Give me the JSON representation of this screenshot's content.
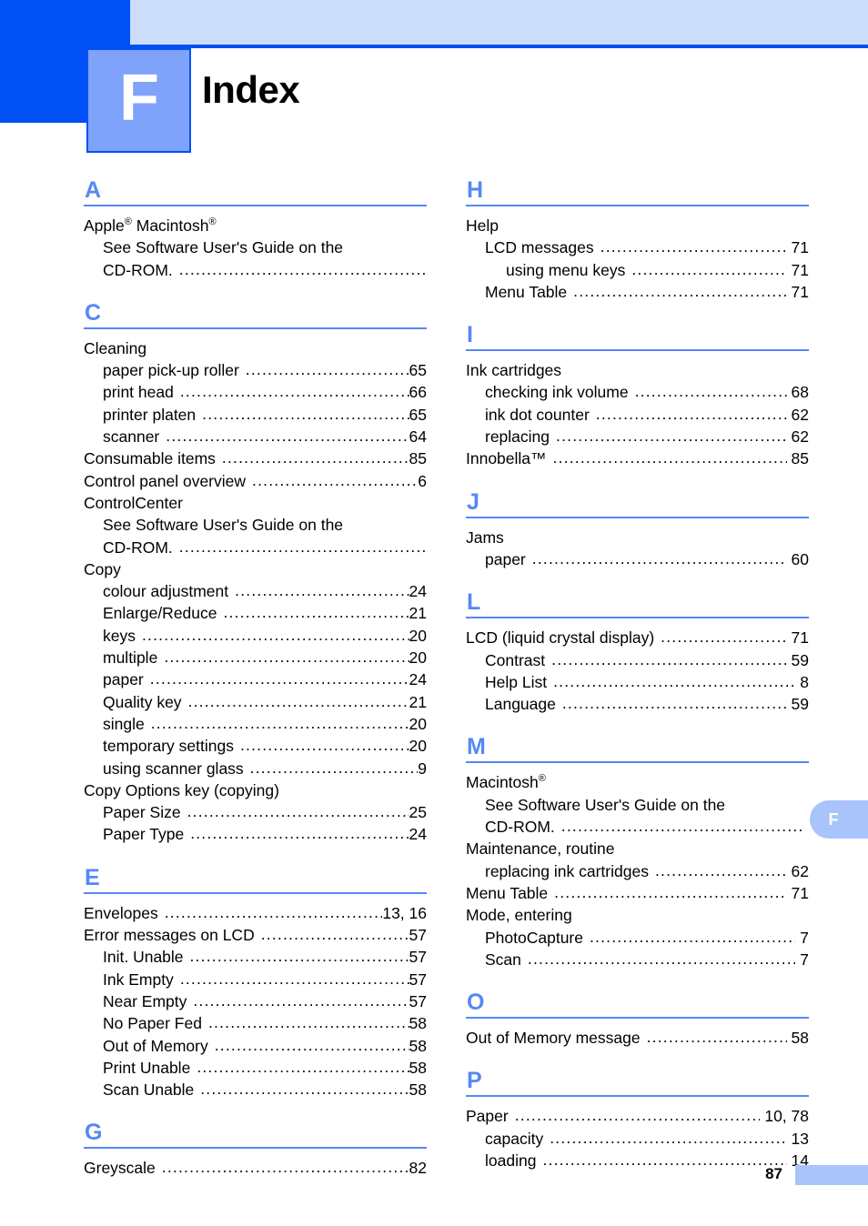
{
  "colors": {
    "brand_blue": "#0050f5",
    "band_blue": "#ccdcfb",
    "chapter_box_blue": "#7fa2fa",
    "heading_blue": "#5588f5",
    "tab_blue": "#a9c3fb"
  },
  "header": {
    "chapter_letter": "F",
    "title": "Index"
  },
  "edge_tab": {
    "label": "F"
  },
  "footer": {
    "page_number": "87"
  },
  "leader": "..................................................................................................",
  "columns": {
    "left": [
      {
        "letter": "A",
        "entries": [
          {
            "level": 1,
            "text": "Apple® Macintosh®",
            "page": "",
            "leader": false,
            "html": true
          },
          {
            "level": 2,
            "text": "See Software User's Guide on the",
            "page": "",
            "leader": false
          },
          {
            "level": 2,
            "text": "CD-ROM.",
            "page": "",
            "leader": true
          }
        ]
      },
      {
        "letter": "C",
        "entries": [
          {
            "level": 1,
            "text": "Cleaning",
            "page": "",
            "leader": false
          },
          {
            "level": 2,
            "text": "paper pick-up roller",
            "page": "65",
            "leader": true
          },
          {
            "level": 2,
            "text": "print head",
            "page": "66",
            "leader": true
          },
          {
            "level": 2,
            "text": "printer platen",
            "page": "65",
            "leader": true
          },
          {
            "level": 2,
            "text": "scanner",
            "page": "64",
            "leader": true
          },
          {
            "level": 1,
            "text": "Consumable items",
            "page": "85",
            "leader": true
          },
          {
            "level": 1,
            "text": "Control panel overview",
            "page": "6",
            "leader": true
          },
          {
            "level": 1,
            "text": "ControlCenter",
            "page": "",
            "leader": false
          },
          {
            "level": 2,
            "text": "See Software User's Guide on the",
            "page": "",
            "leader": false
          },
          {
            "level": 2,
            "text": "CD-ROM.",
            "page": "",
            "leader": true
          },
          {
            "level": 1,
            "text": "Copy",
            "page": "",
            "leader": false
          },
          {
            "level": 2,
            "text": "colour adjustment",
            "page": "24",
            "leader": true
          },
          {
            "level": 2,
            "text": "Enlarge/Reduce",
            "page": "21",
            "leader": true
          },
          {
            "level": 2,
            "text": "keys",
            "page": "20",
            "leader": true
          },
          {
            "level": 2,
            "text": "multiple",
            "page": "20",
            "leader": true
          },
          {
            "level": 2,
            "text": "paper",
            "page": "24",
            "leader": true
          },
          {
            "level": 2,
            "text": "Quality key",
            "page": "21",
            "leader": true
          },
          {
            "level": 2,
            "text": "single",
            "page": "20",
            "leader": true
          },
          {
            "level": 2,
            "text": "temporary settings",
            "page": "20",
            "leader": true
          },
          {
            "level": 2,
            "text": "using scanner glass",
            "page": "9",
            "leader": true
          },
          {
            "level": 1,
            "text": "Copy Options key (copying)",
            "page": "",
            "leader": false
          },
          {
            "level": 2,
            "text": "Paper Size",
            "page": "25",
            "leader": true
          },
          {
            "level": 2,
            "text": "Paper Type",
            "page": "24",
            "leader": true
          }
        ]
      },
      {
        "letter": "E",
        "entries": [
          {
            "level": 1,
            "text": "Envelopes",
            "page": "13, 16",
            "leader": true
          },
          {
            "level": 1,
            "text": "Error messages on LCD",
            "page": "57",
            "leader": true
          },
          {
            "level": 2,
            "text": "Init. Unable",
            "page": "57",
            "leader": true
          },
          {
            "level": 2,
            "text": "Ink Empty",
            "page": "57",
            "leader": true
          },
          {
            "level": 2,
            "text": "Near Empty",
            "page": "57",
            "leader": true
          },
          {
            "level": 2,
            "text": "No Paper Fed",
            "page": "58",
            "leader": true
          },
          {
            "level": 2,
            "text": "Out of Memory",
            "page": "58",
            "leader": true
          },
          {
            "level": 2,
            "text": "Print Unable",
            "page": "58",
            "leader": true
          },
          {
            "level": 2,
            "text": "Scan Unable",
            "page": "58",
            "leader": true
          }
        ]
      },
      {
        "letter": "G",
        "entries": [
          {
            "level": 1,
            "text": "Greyscale",
            "page": "82",
            "leader": true
          }
        ]
      }
    ],
    "right": [
      {
        "letter": "H",
        "entries": [
          {
            "level": 1,
            "text": "Help",
            "page": "",
            "leader": false
          },
          {
            "level": 2,
            "text": "LCD messages",
            "page": "71",
            "leader": true
          },
          {
            "level": 3,
            "text": "using menu keys",
            "page": "71",
            "leader": true
          },
          {
            "level": 2,
            "text": "Menu Table",
            "page": "71",
            "leader": true
          }
        ]
      },
      {
        "letter": "I",
        "entries": [
          {
            "level": 1,
            "text": "Ink cartridges",
            "page": "",
            "leader": false
          },
          {
            "level": 2,
            "text": "checking ink volume",
            "page": "68",
            "leader": true
          },
          {
            "level": 2,
            "text": "ink dot counter",
            "page": "62",
            "leader": true
          },
          {
            "level": 2,
            "text": "replacing",
            "page": "62",
            "leader": true
          },
          {
            "level": 1,
            "text": "Innobella™",
            "page": "85",
            "leader": true
          }
        ]
      },
      {
        "letter": "J",
        "entries": [
          {
            "level": 1,
            "text": "Jams",
            "page": "",
            "leader": false
          },
          {
            "level": 2,
            "text": "paper",
            "page": "60",
            "leader": true
          }
        ]
      },
      {
        "letter": "L",
        "entries": [
          {
            "level": 1,
            "text": "LCD (liquid crystal display)",
            "page": "71",
            "leader": true
          },
          {
            "level": 2,
            "text": "Contrast",
            "page": "59",
            "leader": true
          },
          {
            "level": 2,
            "text": "Help List",
            "page": "8",
            "leader": true
          },
          {
            "level": 2,
            "text": "Language",
            "page": "59",
            "leader": true
          }
        ]
      },
      {
        "letter": "M",
        "entries": [
          {
            "level": 1,
            "text": "Macintosh®",
            "page": "",
            "leader": false,
            "html": true
          },
          {
            "level": 2,
            "text": "See Software User's Guide on the",
            "page": "",
            "leader": false
          },
          {
            "level": 2,
            "text": "CD-ROM.",
            "page": "",
            "leader": true
          },
          {
            "level": 1,
            "text": "Maintenance, routine",
            "page": "",
            "leader": false
          },
          {
            "level": 2,
            "text": "replacing ink cartridges",
            "page": "62",
            "leader": true
          },
          {
            "level": 1,
            "text": "Menu Table",
            "page": "71",
            "leader": true
          },
          {
            "level": 1,
            "text": "Mode, entering",
            "page": "",
            "leader": false
          },
          {
            "level": 2,
            "text": "PhotoCapture",
            "page": "7",
            "leader": true
          },
          {
            "level": 2,
            "text": "Scan",
            "page": "7",
            "leader": true
          }
        ]
      },
      {
        "letter": "O",
        "entries": [
          {
            "level": 1,
            "text": "Out of Memory message",
            "page": "58",
            "leader": true
          }
        ]
      },
      {
        "letter": "P",
        "entries": [
          {
            "level": 1,
            "text": "Paper",
            "page": "10, 78",
            "leader": true
          },
          {
            "level": 2,
            "text": "capacity",
            "page": "13",
            "leader": true
          },
          {
            "level": 2,
            "text": "loading",
            "page": "14",
            "leader": true
          }
        ]
      }
    ]
  }
}
